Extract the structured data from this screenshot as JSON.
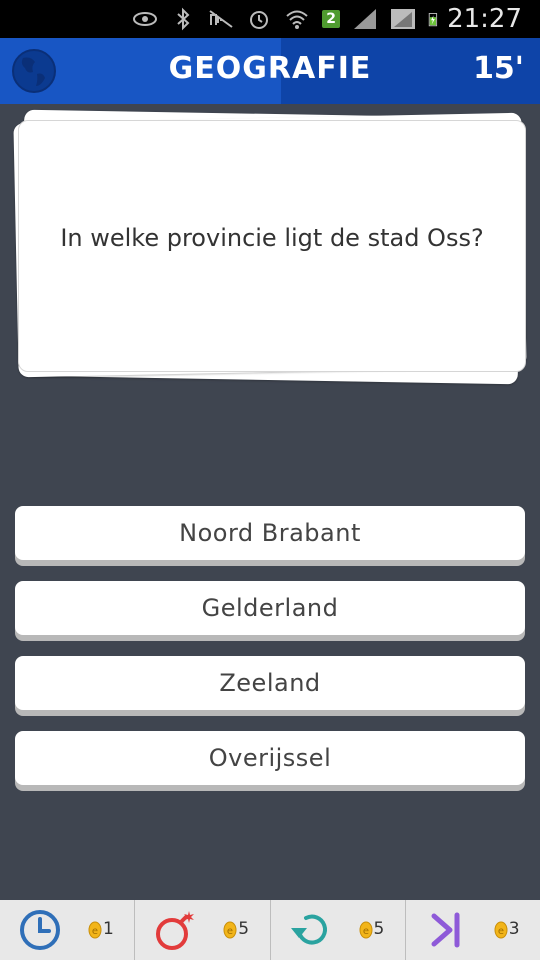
{
  "status_bar": {
    "time": "21:27",
    "notification_badge": "2"
  },
  "header": {
    "title": "GEOGRAFIE",
    "timer": "15'",
    "category_icon": "globe-icon"
  },
  "question": {
    "text": "In welke provincie ligt de stad Oss?"
  },
  "answers": [
    "Noord Brabant",
    "Gelderland",
    "Zeeland",
    "Overijssel"
  ],
  "jokers": [
    {
      "icon": "clock-icon",
      "cost": "1",
      "color": "#2f6fb8"
    },
    {
      "icon": "bomb-icon",
      "cost": "5",
      "color": "#e23b3b"
    },
    {
      "icon": "refresh-icon",
      "cost": "5",
      "color": "#2aa3a0"
    },
    {
      "icon": "skip-icon",
      "cost": "3",
      "color": "#8e5ad8"
    }
  ],
  "colors": {
    "header": "#1856c4",
    "background": "#3f4550",
    "coin": "#f2b51a"
  }
}
